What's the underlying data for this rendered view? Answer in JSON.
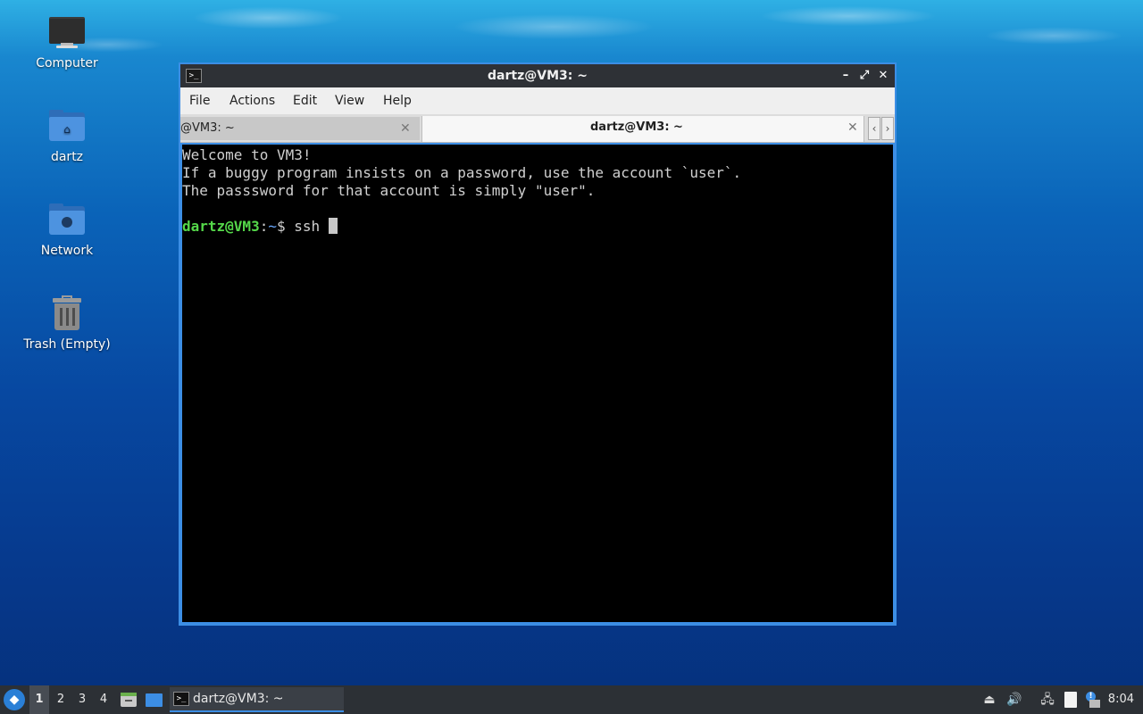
{
  "desktop": {
    "icons": [
      {
        "label": "Computer",
        "icon": "computer-icon"
      },
      {
        "label": "dartz",
        "icon": "home-folder-icon"
      },
      {
        "label": "Network",
        "icon": "network-folder-icon"
      },
      {
        "label": "Trash (Empty)",
        "icon": "trash-icon"
      }
    ]
  },
  "window": {
    "title": "dartz@VM3: ~",
    "controls": {
      "minimize": "–",
      "maximize": "⤢",
      "close": "✕"
    },
    "menu": [
      "File",
      "Actions",
      "Edit",
      "View",
      "Help"
    ],
    "tabs": [
      {
        "label": "@VM3: ~",
        "active": false
      },
      {
        "label": "dartz@VM3: ~",
        "active": true
      }
    ],
    "tab_scroll": {
      "left": "‹",
      "right": "›"
    },
    "terminal": {
      "lines": [
        "Welcome to VM3!",
        "If a buggy program insists on a password, use the account `user`.",
        "The passsword for that account is simply \"user\"."
      ],
      "prompt_user": "dartz@VM3",
      "prompt_sep": ":",
      "prompt_path": "~",
      "prompt_symbol": "$ ",
      "command": "ssh "
    }
  },
  "taskbar": {
    "workspaces": [
      "1",
      "2",
      "3",
      "4"
    ],
    "active_workspace": "1",
    "task_label": "dartz@VM3: ~",
    "clock": "8:04",
    "accent": "#3c8ee5"
  }
}
